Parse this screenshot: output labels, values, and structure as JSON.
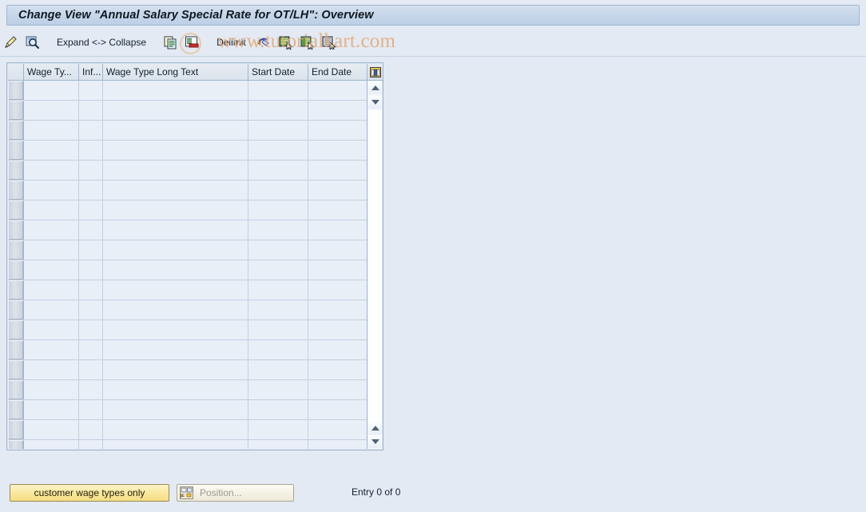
{
  "window": {
    "title": "Change View \"Annual Salary Special Rate for OT/LH\": Overview"
  },
  "watermark": {
    "text": "www.tutorialkart.com",
    "color": "#e3ab7a"
  },
  "toolbar": {
    "items": [
      {
        "icon": "pencil-display-change-icon",
        "label": ""
      },
      {
        "icon": "magnifier-details-icon",
        "label": ""
      },
      {
        "icon": "",
        "label": "Expand <-> Collapse"
      },
      {
        "icon": "copy-as-icon",
        "label": ""
      },
      {
        "icon": "delete-row-icon",
        "label": ""
      },
      {
        "icon": "",
        "label": "Delimit"
      },
      {
        "icon": "undo-delimit-icon",
        "label": ""
      },
      {
        "icon": "select-all-entries-icon",
        "label": ""
      },
      {
        "icon": "select-block-icon",
        "label": ""
      },
      {
        "icon": "deselect-all-icon",
        "label": ""
      }
    ],
    "expand_collapse_label": "Expand <-> Collapse",
    "delimit_label": "Delimit"
  },
  "table": {
    "columns": [
      {
        "key": "selector",
        "label": ""
      },
      {
        "key": "wage_type",
        "label": "Wage Ty..."
      },
      {
        "key": "infotype",
        "label": "Inf..."
      },
      {
        "key": "long_text",
        "label": "Wage Type Long Text"
      },
      {
        "key": "start_date",
        "label": "Start Date"
      },
      {
        "key": "end_date",
        "label": "End Date"
      }
    ],
    "config_icon": "table-settings-icon",
    "rows": [],
    "empty_row_count": 19,
    "scroll": {
      "up_icon": "scroll-up-icon",
      "down_icon": "scroll-down-icon",
      "page_up_icon": "page-up-icon",
      "page_down_icon": "page-down-icon"
    }
  },
  "footer": {
    "customer_button_label": "customer wage types only",
    "position_button_label": "Position...",
    "position_icon": "position-icon",
    "entry_status": "Entry 0 of 0"
  },
  "colors": {
    "background": "#e3eaf3",
    "title_bar": "#c7d6e9",
    "grid_cell": "#e9eff7",
    "accent_yellow": "#f5dd85",
    "border": "#9fb6ce"
  }
}
